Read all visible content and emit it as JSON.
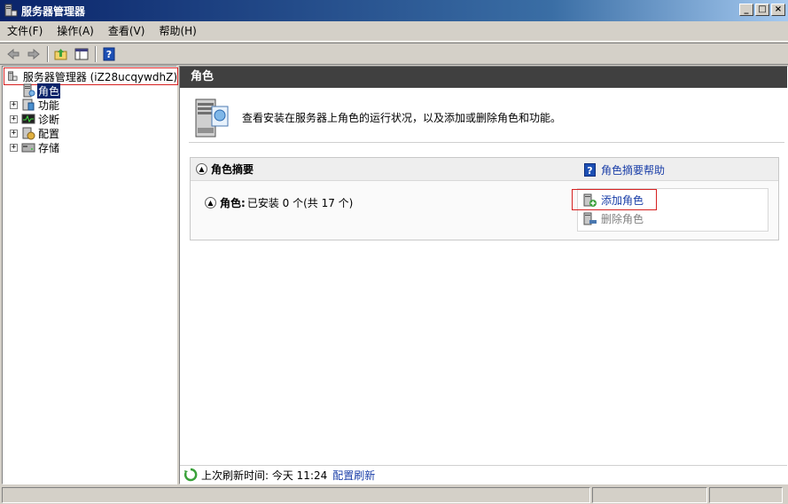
{
  "window": {
    "title": "服务器管理器",
    "buttons": [
      "minimize",
      "maximize",
      "close"
    ]
  },
  "menu": [
    {
      "label": "文件(F)"
    },
    {
      "label": "操作(A)"
    },
    {
      "label": "查看(V)"
    },
    {
      "label": "帮助(H)"
    }
  ],
  "toolbar": {
    "buttons": [
      "back-icon",
      "forward-icon",
      "up-folder-icon",
      "show-hide-tree-icon",
      "help-icon"
    ]
  },
  "tree": {
    "root_label": "服务器管理器 (iZ28ucqywdhZ)",
    "items": [
      {
        "label": "角色",
        "expandable": false,
        "selected": true
      },
      {
        "label": "功能",
        "expandable": true,
        "selected": false
      },
      {
        "label": "诊断",
        "expandable": true,
        "selected": false
      },
      {
        "label": "配置",
        "expandable": true,
        "selected": false
      },
      {
        "label": "存储",
        "expandable": true,
        "selected": false
      }
    ]
  },
  "main": {
    "header": "角色",
    "intro_text": "查看安装在服务器上角色的运行状况，以及添加或删除角色和功能。",
    "summary": {
      "title": "角色摘要",
      "help_link": "角色摘要帮助",
      "roles_label": "角色:",
      "roles_status": "已安装 0 个(共 17 个)",
      "actions": {
        "add": "添加角色",
        "remove": "删除角色"
      }
    },
    "refresh": {
      "text": "上次刷新时间: 今天 11:24",
      "link": "配置刷新"
    }
  },
  "colors": {
    "title_bar": "#0a246a",
    "pane_header": "#404040",
    "link": "#1a3ea8",
    "highlight_border": "#d62020",
    "selection": "#0a246a"
  }
}
